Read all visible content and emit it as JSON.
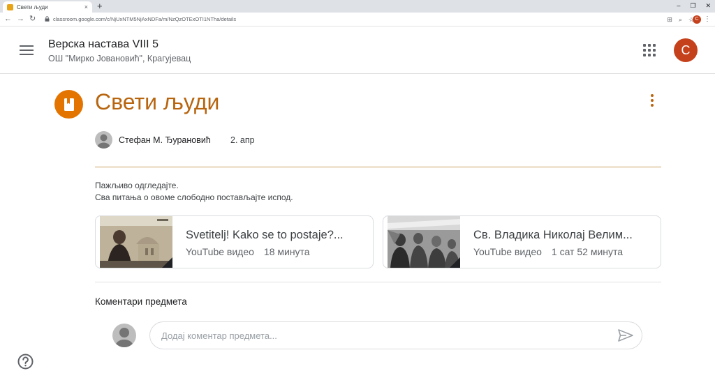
{
  "browser": {
    "tab_title": "Свети људи",
    "tab_close_glyph": "×",
    "new_tab_glyph": "+",
    "window_controls": [
      "–",
      "❐",
      "✕"
    ],
    "url": "classroom.google.com/c/NjUxNTM5NjAxNDFa/m/NzQzOTExOTI1NTha/details",
    "back_glyph": "←",
    "forward_glyph": "→",
    "reload_glyph": "↻",
    "tool_icons": [
      "⊞",
      "⌕",
      "☆",
      "⚲"
    ],
    "profile_initial": "C"
  },
  "header": {
    "class_name": "Верска настава VIII 5",
    "school_name": "ОШ \"Мирко Јовановић\", Крагујевац",
    "account_initial": "C"
  },
  "material": {
    "title": "Свети људи",
    "author": "Стефан М. Ђурановић",
    "date": "2. апр",
    "description_lines": [
      "Пажљиво одгледајте.",
      "Сва питања о овоме слободно постављајте испод."
    ],
    "attachments": [
      {
        "title": "Svetitelj! Kako se to postaje?...",
        "type": "YouTube видео",
        "duration": "18 минута"
      },
      {
        "title": "Св. Владика Николај Велим...",
        "type": "YouTube видео",
        "duration": "1 сат 52 минута"
      }
    ]
  },
  "comments": {
    "heading": "Коментари предмета",
    "placeholder": "Додај коментар предмета..."
  },
  "colors": {
    "accent": "#b8650f",
    "accent_circle": "#e37400",
    "divider": "#c9a15c",
    "avatar_red": "#c5411c",
    "favicon": "#e8a317"
  },
  "icons": {
    "menu": "hamburger-menu-icon",
    "apps": "google-apps-icon",
    "material": "book-icon",
    "more": "more-vert-icon",
    "send": "send-icon",
    "help": "help-icon"
  }
}
